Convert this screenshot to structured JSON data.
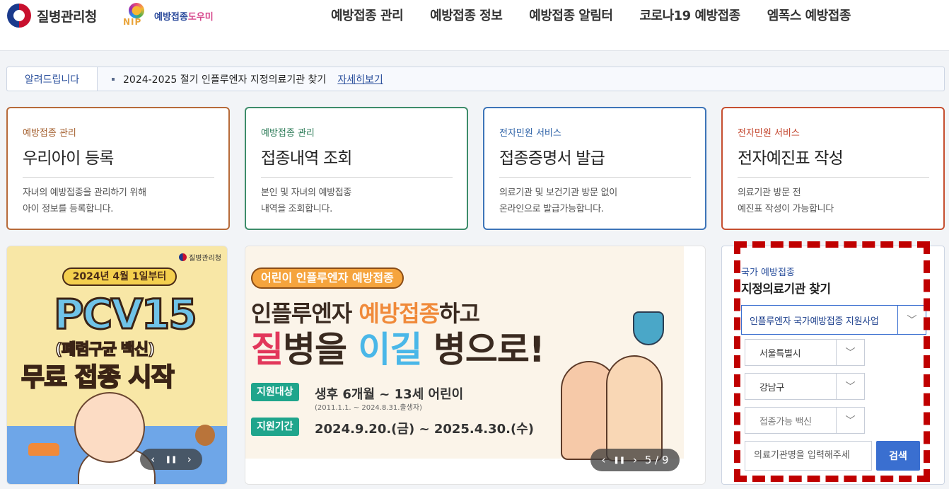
{
  "header": {
    "kdca_name": "질병관리청",
    "nip_letters": "NIP",
    "nip_name_part1": "예방접종",
    "nip_name_part2": "도우미",
    "nav": [
      "예방접종 관리",
      "예방접종 정보",
      "예방접종 알림터",
      "코로나19 예방접종",
      "엠폭스 예방접종"
    ]
  },
  "notice": {
    "label": "알려드립니다",
    "text": "2024-2025 절기 인플루엔자 지정의료기관 찾기",
    "more": "자세히보기"
  },
  "cards": [
    {
      "category": "예방접종 관리",
      "title": "우리아이 등록",
      "desc1": "자녀의 예방접종을 관리하기 위해",
      "desc2": "아이 정보를 등록합니다."
    },
    {
      "category": "예방접종 관리",
      "title": "접종내역 조회",
      "desc1": "본인 및 자녀의 예방접종",
      "desc2": "내역을 조회합니다."
    },
    {
      "category": "전자민원 서비스",
      "title": "접종증명서 발급",
      "desc1": "의료기관 및 보건기관 방문 없이",
      "desc2": "온라인으로 발급가능합니다."
    },
    {
      "category": "전자민원 서비스",
      "title": "전자예진표 작성",
      "desc1": "의료기관 방문 전",
      "desc2": "예진표 작성이 가능합니다"
    }
  ],
  "banner_left": {
    "agency": "질병관리청",
    "date": "2024년 4월 1일부터",
    "headline": "PCV15",
    "subtitle": "(폐렴구균 백신)",
    "tagline": "무료 접종 시작",
    "prev": "‹",
    "pause": "❚❚",
    "next": "›"
  },
  "banner_mid": {
    "pill": "어린이 인플루엔자 예방접종",
    "line1_a": "인플루엔자 ",
    "line1_hl": "예방접종",
    "line1_b": "하고",
    "line2_r": "질",
    "line2_a": "병을 ",
    "line2_b": "이길",
    "line2_c": " 병으로!",
    "tag1": "지원대상",
    "val1": "생후 6개월 ~ 13세 어린이",
    "note1": "(2011.1.1. ~ 2024.8.31.출생자)",
    "tag2": "지원기간",
    "val2": "2024.9.20.(금) ~ 2025.4.30.(수)",
    "prev": "‹",
    "pause": "❚❚",
    "next": "›",
    "page": "5 / 9"
  },
  "finder": {
    "subtitle": "국가 예방접종",
    "title": "지정의료기관 찾기",
    "program": "인플루엔자 국가예방접종 지원사업",
    "city": "서울특별시",
    "district": "강남구",
    "vaccine_placeholder": "접종가능 백신",
    "search_placeholder": "의료기관명을 입력해주세",
    "search_button": "검색"
  },
  "colors": {
    "accent_blue": "#3a6fd0",
    "highlight_red": "#c00000"
  }
}
